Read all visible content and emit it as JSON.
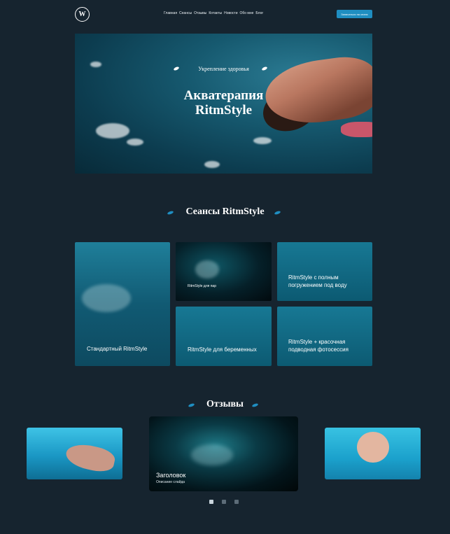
{
  "header": {
    "logo_letter": "W",
    "nav": [
      "Главная",
      "Сеансы",
      "Отзывы",
      "Котакты",
      "Новости",
      "Обо мне",
      "Блог"
    ],
    "cta_label": "Записаться на сеанс"
  },
  "hero": {
    "subtitle": "Укрепление здоровья",
    "title_line1": "Акватерапия",
    "title_line2": "RitmStyle"
  },
  "sessions": {
    "title": "Сеансы RitmStyle",
    "cards": [
      "Стандартный RitmStyle",
      "RitmStyle для пар",
      "RitmStyle с полным погружением под воду",
      "RitmStyle для беременных",
      "RitmStyle + красочная подводная фотосессия"
    ]
  },
  "reviews": {
    "title": "Отзывы",
    "slide_title": "Заголовок",
    "slide_desc": "Описание слайда",
    "slides_total": 3,
    "active_slide": 1
  },
  "colors": {
    "background": "#16242f",
    "accent": "#1f8ec1"
  }
}
